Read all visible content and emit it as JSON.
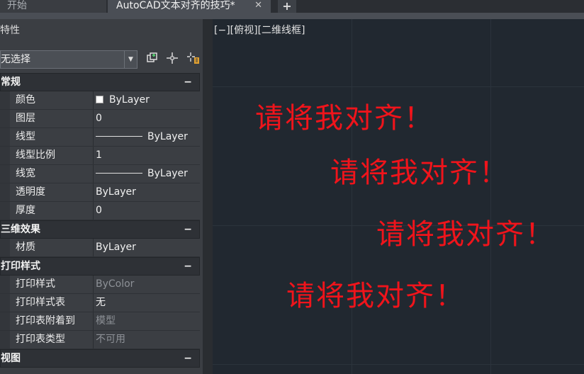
{
  "tabs": {
    "start": "开始",
    "document": "AutoCAD文本对齐的技巧*",
    "close_glyph": "✕",
    "add_glyph": "+"
  },
  "properties": {
    "title": "特性",
    "selection": "无选择",
    "icons": [
      "quick-select-icon",
      "select-objects-icon",
      "toggle-pickadd-icon"
    ],
    "sections": [
      {
        "title": "常规",
        "collapse": "−",
        "rows": [
          {
            "label": "颜色",
            "value": "ByLayer",
            "swatch": "#ffffff"
          },
          {
            "label": "图层",
            "value": "0"
          },
          {
            "label": "线型",
            "value": "ByLayer",
            "line_sample": true
          },
          {
            "label": "线型比例",
            "value": "1"
          },
          {
            "label": "线宽",
            "value": "ByLayer",
            "line_sample": true
          },
          {
            "label": "透明度",
            "value": "ByLayer"
          },
          {
            "label": "厚度",
            "value": "0"
          }
        ]
      },
      {
        "title": "三维效果",
        "collapse": "−",
        "rows": [
          {
            "label": "材质",
            "value": "ByLayer"
          }
        ]
      },
      {
        "title": "打印样式",
        "collapse": "−",
        "rows": [
          {
            "label": "打印样式",
            "value": "ByColor",
            "disabled": true
          },
          {
            "label": "打印样式表",
            "value": "无"
          },
          {
            "label": "打印表附着到",
            "value": "模型",
            "disabled": true
          },
          {
            "label": "打印表类型",
            "value": "不可用",
            "disabled": true
          }
        ]
      },
      {
        "title": "视图",
        "collapse": "−",
        "rows": []
      }
    ]
  },
  "drawing": {
    "viewport_label": "[−][俯视][二维线框]",
    "texts": [
      "请将我对齐！",
      "请将我对齐！",
      "请将我对齐！",
      "请将我对齐！"
    ],
    "text_color": "#f0141b",
    "background": "#212830"
  }
}
